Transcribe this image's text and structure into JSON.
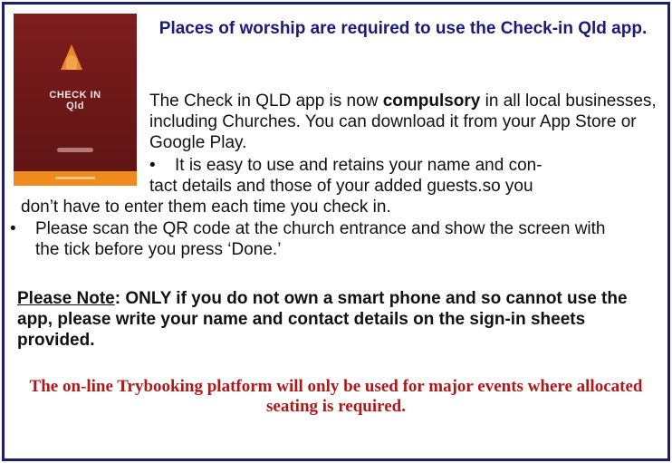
{
  "app_image": {
    "title": "CHECK IN\nQld"
  },
  "heading": "Places of worship are required to use the Check-in Qld app.",
  "intro": {
    "before": "The Check in QLD app is now ",
    "emphasis": "compulsory",
    "after": " in all local businesses, including Churches. You can download it from your App Store or Google Play."
  },
  "bullets": [
    {
      "marker": "•",
      "line1": "It is easy to use and retains your name and con-",
      "line2": "tact details and those of your added guests.so you",
      "line3": "don’t have to enter them each time you check in."
    },
    {
      "marker": "•",
      "text": "Please scan the QR code at the church entrance and show the screen with the tick before you press ‘Done.’"
    }
  ],
  "note": {
    "label": "Please Note",
    "colon": ":",
    "text": "  ONLY if you do not own a smart phone and so cannot use the app, please write your name and contact details on the sign-in sheets provided."
  },
  "footer": "The on-line Trybooking platform will only be used for major events where allocated seating is required.",
  "colors": {
    "border": "#1e1e6e",
    "heading": "#1a1a7a",
    "footer": "#b01818",
    "app_background": "#6a1717",
    "app_accent": "#ef8a1c"
  }
}
